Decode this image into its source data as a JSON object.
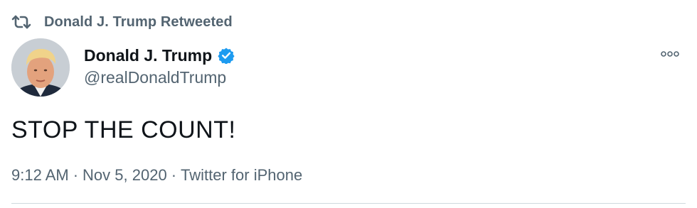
{
  "retweet": {
    "icon": "retweet-icon",
    "text": "Donald J. Trump Retweeted"
  },
  "author": {
    "display_name": "Donald J. Trump",
    "handle": "@realDonaldTrump",
    "verified_icon": "verified-badge-icon",
    "verified_color": "#1d9bf0"
  },
  "tweet": {
    "text": "STOP THE COUNT!"
  },
  "meta": {
    "time": "9:12 AM",
    "separator": "·",
    "date": "Nov 5, 2020",
    "source": "Twitter for iPhone"
  },
  "more_icon": "more-options-icon",
  "colors": {
    "primary_text": "#0f1419",
    "secondary_text": "#536471",
    "divider": "#cfd9de"
  }
}
